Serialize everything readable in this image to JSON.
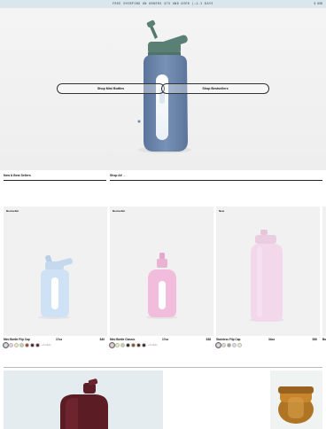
{
  "announcement": {
    "prev_arrow": "←",
    "text": "FREE SHIPPING ON ORDERS $75 AND OVER | 1-2 DAYS",
    "next_arrow": "→",
    "region": "$ USD"
  },
  "hero": {
    "left_button": "Shop Mini Bottles",
    "right_button": "Shop Bestsellers"
  },
  "filters": {
    "left": "New & Best Sellers",
    "right": "Shop All →"
  },
  "products": [
    {
      "badge": "Bestseller",
      "name": "Mini Bottle Flip Cap",
      "size": "17oz",
      "price": "$40",
      "swatches": [
        "#d5e4f3",
        "#f3cfe2",
        "#eeeeaa",
        "#c5d8a3",
        "#8c4a2b",
        "#3a2421",
        "#5a1f25"
      ],
      "more": "+4 colors"
    },
    {
      "badge": "Bestseller",
      "name": "Mini Bottle Classic",
      "size": "17oz",
      "price": "$38",
      "swatches": [
        "#f0c6e2",
        "#eeeeaa",
        "#c5d8a3",
        "#222222",
        "#8c4a2b",
        "#5a1f25",
        "#3a2421"
      ],
      "more": "+4 colors"
    },
    {
      "badge": "New",
      "name": "Stainless Flip Cap",
      "size": "34oz",
      "price": "$50",
      "swatches": [
        "#f1d4ea",
        "#d8dfc9",
        "#9aa48a",
        "#cfe0f0",
        "#f3ecc2"
      ],
      "more": ""
    },
    {
      "badge": "",
      "name": "Bo",
      "size": "",
      "price": "",
      "swatches": [],
      "more": ""
    }
  ],
  "colors": {
    "announce_bg": "#d9e6ec",
    "hero_bottle": "#6e87ab",
    "hero_cap": "#5a8076",
    "mini_flip": "#cfe2f5",
    "mini_classic": "#f2bcdc",
    "stainless_flip": "#f2d8ea"
  }
}
